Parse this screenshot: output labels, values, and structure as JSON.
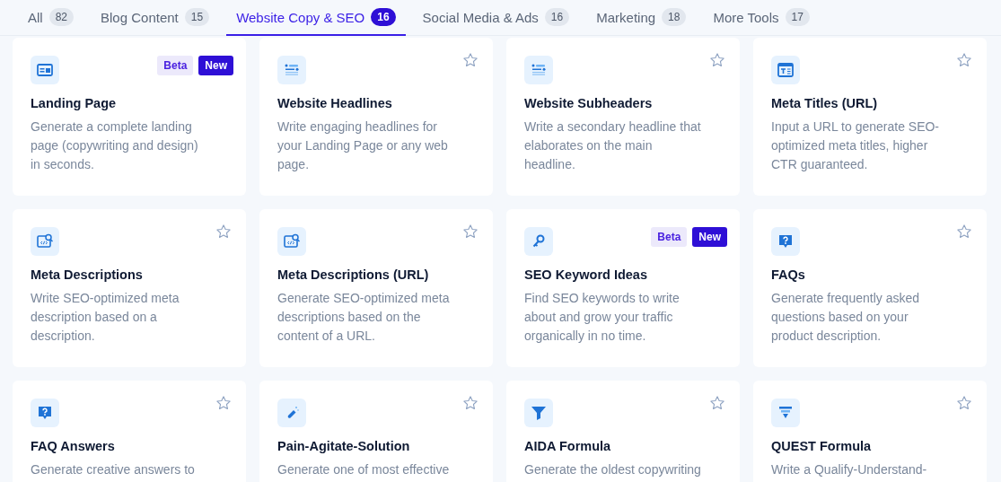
{
  "tabs": [
    {
      "label": "All",
      "count": "82",
      "selected": false
    },
    {
      "label": "Blog Content",
      "count": "15",
      "selected": false
    },
    {
      "label": "Website Copy & SEO",
      "count": "16",
      "selected": true
    },
    {
      "label": "Social Media & Ads",
      "count": "16",
      "selected": false
    },
    {
      "label": "Marketing",
      "count": "18",
      "selected": false
    },
    {
      "label": "More Tools",
      "count": "17",
      "selected": false
    }
  ],
  "cards": [
    {
      "kind": "layout",
      "title": "Landing Page",
      "description": "Generate a complete landing page (copywriting and design) in seconds.",
      "badges": [
        "Beta",
        "New"
      ]
    },
    {
      "kind": "list",
      "title": "Website Headlines",
      "description": "Write engaging headlines for your Landing Page or any web page."
    },
    {
      "kind": "list",
      "title": "Website Subheaders",
      "description": "Write a secondary headline that elaborates on the main headline."
    },
    {
      "kind": "title",
      "title": "Meta Titles (URL)",
      "description": "Input a URL to generate SEO-optimized meta titles, higher CTR guaranteed."
    },
    {
      "kind": "code-search",
      "title": "Meta Descriptions",
      "description": "Write SEO-optimized meta description based on a description."
    },
    {
      "kind": "code-search",
      "title": "Meta Descriptions (URL)",
      "description": "Generate SEO-optimized meta descriptions based on the content of a URL."
    },
    {
      "kind": "key",
      "title": "SEO Keyword Ideas",
      "description": "Find SEO keywords to write about and grow your traffic organically in no time.",
      "badges": [
        "Beta",
        "New"
      ]
    },
    {
      "kind": "question",
      "title": "FAQs",
      "description": "Generate frequently asked questions based on your product description."
    },
    {
      "kind": "question",
      "title": "FAQ Answers",
      "description": "Generate creative answers to"
    },
    {
      "kind": "tube",
      "title": "Pain-Agitate-Solution",
      "description": "Generate one of most effective"
    },
    {
      "kind": "funnel",
      "title": "AIDA Formula",
      "description": "Generate the oldest copywriting"
    },
    {
      "kind": "layers",
      "title": "QUEST Formula",
      "description": "Write a Qualify-Understand-"
    }
  ]
}
